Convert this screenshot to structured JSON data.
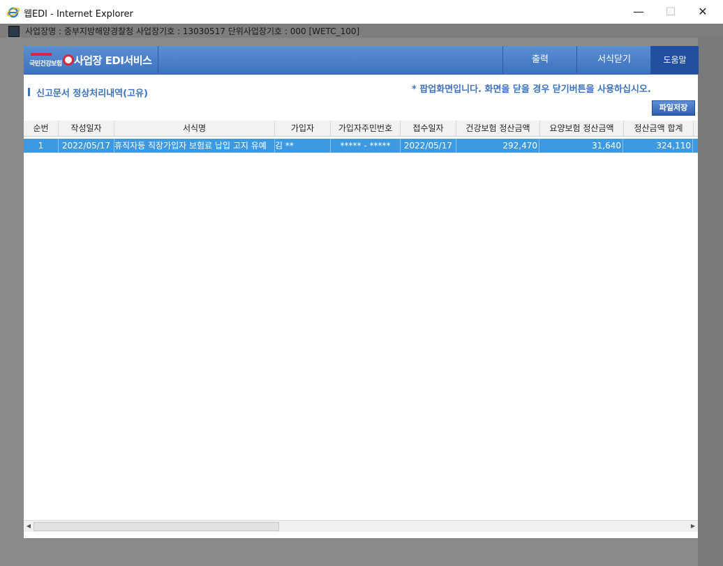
{
  "window": {
    "title": "웹EDI - Internet Explorer",
    "min_glyph": "—",
    "max_glyph": "☐",
    "close_glyph": "✕"
  },
  "background_bar": {
    "text": "사업장명 : 중부지방해양경찰청 사업장기호 : 13030517 단위사업장기호 : 000 [WETC_100]"
  },
  "popup": {
    "logo_text": "국민건강보험",
    "service_title": "사업장 EDI서비스",
    "buttons": {
      "print": "출력",
      "close_form": "서식닫기",
      "help": "도움말"
    },
    "page_title": "신고문서 정상처리내역(고유)",
    "notice": "* 팝업화면입니다. 화면을 닫을 경우 닫기버튼을 사용하십시오.",
    "save_file": "파일저장"
  },
  "table": {
    "columns": [
      "순번",
      "작성일자",
      "서식명",
      "가입자",
      "가입자주민번호",
      "접수일자",
      "건강보험 정산금액",
      "요양보험 정산금액",
      "정산금액 합계"
    ],
    "rows": [
      {
        "no": "1",
        "written_date": "2022/05/17",
        "form_name": "휴직자등 직장가입자 보험료 납입 고지 유예",
        "subscriber": "김 **",
        "resident_no": "***** - *****",
        "received_date": "2022/05/17",
        "health_amount": "292,470",
        "care_amount": "31,640",
        "total_amount": "324,110"
      }
    ]
  },
  "colors": {
    "header_blue": "#3d72bf",
    "selected_row": "#3d9ae2",
    "help_bg": "#1f4f9e"
  },
  "scrollbar": {
    "left_arrow": "◀",
    "right_arrow": "▶"
  }
}
